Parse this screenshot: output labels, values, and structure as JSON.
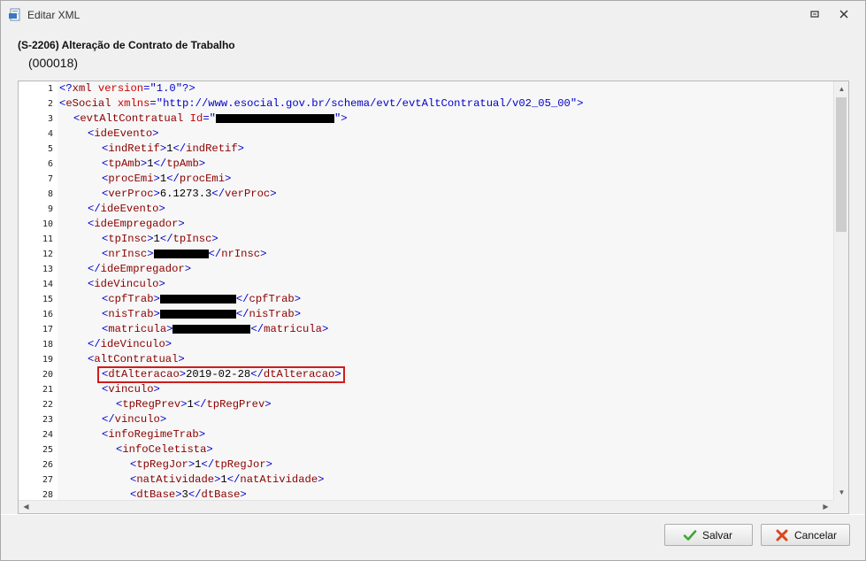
{
  "window": {
    "title": "Editar XML"
  },
  "header": {
    "title": "(S-2206) Alteração de Contrato de Trabalho",
    "subtitle": "(000018)"
  },
  "editor": {
    "lines": [
      {
        "n": "1",
        "indent": 0,
        "segments": [
          [
            "punct",
            "<?"
          ],
          [
            "tag",
            "xml"
          ],
          [
            "attr",
            " version"
          ],
          [
            "punct",
            "="
          ],
          [
            "val",
            "\"1.0\""
          ],
          [
            "punct",
            "?>"
          ]
        ]
      },
      {
        "n": "2",
        "indent": 0,
        "segments": [
          [
            "punct",
            "<"
          ],
          [
            "tag",
            "eSocial"
          ],
          [
            "attr",
            " xmlns"
          ],
          [
            "punct",
            "="
          ],
          [
            "val",
            "\"http://www.esocial.gov.br/schema/evt/evtAltContratual/v02_05_00\""
          ],
          [
            "punct",
            ">"
          ]
        ]
      },
      {
        "n": "3",
        "indent": 1,
        "segments": [
          [
            "punct",
            "<"
          ],
          [
            "tag",
            "evtAltContratual"
          ],
          [
            "attr",
            " Id"
          ],
          [
            "punct",
            "="
          ],
          [
            "val",
            "\""
          ],
          [
            "redact",
            "134"
          ],
          [
            "val",
            "\""
          ],
          [
            "punct",
            ">"
          ]
        ]
      },
      {
        "n": "4",
        "indent": 2,
        "segments": [
          [
            "punct",
            "<"
          ],
          [
            "tag",
            "ideEvento"
          ],
          [
            "punct",
            ">"
          ]
        ]
      },
      {
        "n": "5",
        "indent": 3,
        "segments": [
          [
            "punct",
            "<"
          ],
          [
            "tag",
            "indRetif"
          ],
          [
            "punct",
            ">"
          ],
          [
            "txt",
            "1"
          ],
          [
            "punct",
            "</"
          ],
          [
            "tag",
            "indRetif"
          ],
          [
            "punct",
            ">"
          ]
        ]
      },
      {
        "n": "6",
        "indent": 3,
        "segments": [
          [
            "punct",
            "<"
          ],
          [
            "tag",
            "tpAmb"
          ],
          [
            "punct",
            ">"
          ],
          [
            "txt",
            "1"
          ],
          [
            "punct",
            "</"
          ],
          [
            "tag",
            "tpAmb"
          ],
          [
            "punct",
            ">"
          ]
        ]
      },
      {
        "n": "7",
        "indent": 3,
        "segments": [
          [
            "punct",
            "<"
          ],
          [
            "tag",
            "procEmi"
          ],
          [
            "punct",
            ">"
          ],
          [
            "txt",
            "1"
          ],
          [
            "punct",
            "</"
          ],
          [
            "tag",
            "procEmi"
          ],
          [
            "punct",
            ">"
          ]
        ]
      },
      {
        "n": "8",
        "indent": 3,
        "segments": [
          [
            "punct",
            "<"
          ],
          [
            "tag",
            "verProc"
          ],
          [
            "punct",
            ">"
          ],
          [
            "txt",
            "6.1273.3"
          ],
          [
            "punct",
            "</"
          ],
          [
            "tag",
            "verProc"
          ],
          [
            "punct",
            ">"
          ]
        ]
      },
      {
        "n": "9",
        "indent": 2,
        "segments": [
          [
            "punct",
            "</"
          ],
          [
            "tag",
            "ideEvento"
          ],
          [
            "punct",
            ">"
          ]
        ]
      },
      {
        "n": "10",
        "indent": 2,
        "segments": [
          [
            "punct",
            "<"
          ],
          [
            "tag",
            "ideEmpregador"
          ],
          [
            "punct",
            ">"
          ]
        ]
      },
      {
        "n": "11",
        "indent": 3,
        "segments": [
          [
            "punct",
            "<"
          ],
          [
            "tag",
            "tpInsc"
          ],
          [
            "punct",
            ">"
          ],
          [
            "txt",
            "1"
          ],
          [
            "punct",
            "</"
          ],
          [
            "tag",
            "tpInsc"
          ],
          [
            "punct",
            ">"
          ]
        ]
      },
      {
        "n": "12",
        "indent": 3,
        "segments": [
          [
            "punct",
            "<"
          ],
          [
            "tag",
            "nrInsc"
          ],
          [
            "punct",
            ">"
          ],
          [
            "redact",
            "62"
          ],
          [
            "punct",
            "</"
          ],
          [
            "tag",
            "nrInsc"
          ],
          [
            "punct",
            ">"
          ]
        ]
      },
      {
        "n": "13",
        "indent": 2,
        "segments": [
          [
            "punct",
            "</"
          ],
          [
            "tag",
            "ideEmpregador"
          ],
          [
            "punct",
            ">"
          ]
        ]
      },
      {
        "n": "14",
        "indent": 2,
        "segments": [
          [
            "punct",
            "<"
          ],
          [
            "tag",
            "ideVinculo"
          ],
          [
            "punct",
            ">"
          ]
        ]
      },
      {
        "n": "15",
        "indent": 3,
        "segments": [
          [
            "punct",
            "<"
          ],
          [
            "tag",
            "cpfTrab"
          ],
          [
            "punct",
            ">"
          ],
          [
            "redact",
            "86"
          ],
          [
            "punct",
            "</"
          ],
          [
            "tag",
            "cpfTrab"
          ],
          [
            "punct",
            ">"
          ]
        ]
      },
      {
        "n": "16",
        "indent": 3,
        "segments": [
          [
            "punct",
            "<"
          ],
          [
            "tag",
            "nisTrab"
          ],
          [
            "punct",
            ">"
          ],
          [
            "redact",
            "86"
          ],
          [
            "punct",
            "</"
          ],
          [
            "tag",
            "nisTrab"
          ],
          [
            "punct",
            ">"
          ]
        ]
      },
      {
        "n": "17",
        "indent": 3,
        "segments": [
          [
            "punct",
            "<"
          ],
          [
            "tag",
            "matricula"
          ],
          [
            "punct",
            ">"
          ],
          [
            "redact",
            "88"
          ],
          [
            "punct",
            "</"
          ],
          [
            "tag",
            "matricula"
          ],
          [
            "punct",
            ">"
          ]
        ]
      },
      {
        "n": "18",
        "indent": 2,
        "segments": [
          [
            "punct",
            "</"
          ],
          [
            "tag",
            "ideVinculo"
          ],
          [
            "punct",
            ">"
          ]
        ]
      },
      {
        "n": "19",
        "indent": 2,
        "segments": [
          [
            "punct",
            "<"
          ],
          [
            "tag",
            "altContratual"
          ],
          [
            "punct",
            ">"
          ]
        ]
      },
      {
        "n": "20",
        "indent": 3,
        "highlight": true,
        "segments": [
          [
            "punct",
            "<"
          ],
          [
            "tag",
            "dtAlteracao"
          ],
          [
            "punct",
            ">"
          ],
          [
            "txt",
            "2019-02-28"
          ],
          [
            "punct",
            "</"
          ],
          [
            "tag",
            "dtAlteracao"
          ],
          [
            "punct",
            ">"
          ]
        ]
      },
      {
        "n": "21",
        "indent": 3,
        "segments": [
          [
            "punct",
            "<"
          ],
          [
            "tag",
            "vinculo"
          ],
          [
            "punct",
            ">"
          ]
        ]
      },
      {
        "n": "22",
        "indent": 4,
        "segments": [
          [
            "punct",
            "<"
          ],
          [
            "tag",
            "tpRegPrev"
          ],
          [
            "punct",
            ">"
          ],
          [
            "txt",
            "1"
          ],
          [
            "punct",
            "</"
          ],
          [
            "tag",
            "tpRegPrev"
          ],
          [
            "punct",
            ">"
          ]
        ]
      },
      {
        "n": "23",
        "indent": 3,
        "segments": [
          [
            "punct",
            "</"
          ],
          [
            "tag",
            "vinculo"
          ],
          [
            "punct",
            ">"
          ]
        ]
      },
      {
        "n": "24",
        "indent": 3,
        "segments": [
          [
            "punct",
            "<"
          ],
          [
            "tag",
            "infoRegimeTrab"
          ],
          [
            "punct",
            ">"
          ]
        ]
      },
      {
        "n": "25",
        "indent": 4,
        "segments": [
          [
            "punct",
            "<"
          ],
          [
            "tag",
            "infoCeletista"
          ],
          [
            "punct",
            ">"
          ]
        ]
      },
      {
        "n": "26",
        "indent": 5,
        "segments": [
          [
            "punct",
            "<"
          ],
          [
            "tag",
            "tpRegJor"
          ],
          [
            "punct",
            ">"
          ],
          [
            "txt",
            "1"
          ],
          [
            "punct",
            "</"
          ],
          [
            "tag",
            "tpRegJor"
          ],
          [
            "punct",
            ">"
          ]
        ]
      },
      {
        "n": "27",
        "indent": 5,
        "segments": [
          [
            "punct",
            "<"
          ],
          [
            "tag",
            "natAtividade"
          ],
          [
            "punct",
            ">"
          ],
          [
            "txt",
            "1"
          ],
          [
            "punct",
            "</"
          ],
          [
            "tag",
            "natAtividade"
          ],
          [
            "punct",
            ">"
          ]
        ]
      },
      {
        "n": "28",
        "indent": 5,
        "segments": [
          [
            "punct",
            "<"
          ],
          [
            "tag",
            "dtBase"
          ],
          [
            "punct",
            ">"
          ],
          [
            "txt",
            "3"
          ],
          [
            "punct",
            "</"
          ],
          [
            "tag",
            "dtBase"
          ],
          [
            "punct",
            ">"
          ]
        ]
      }
    ]
  },
  "buttons": {
    "save_label": "Salvar",
    "cancel_label": "Cancelar"
  },
  "colors": {
    "highlight_border": "#d01c1c",
    "tag": "#8b0000",
    "attribute": "#cc0000",
    "value": "#0000cc"
  }
}
